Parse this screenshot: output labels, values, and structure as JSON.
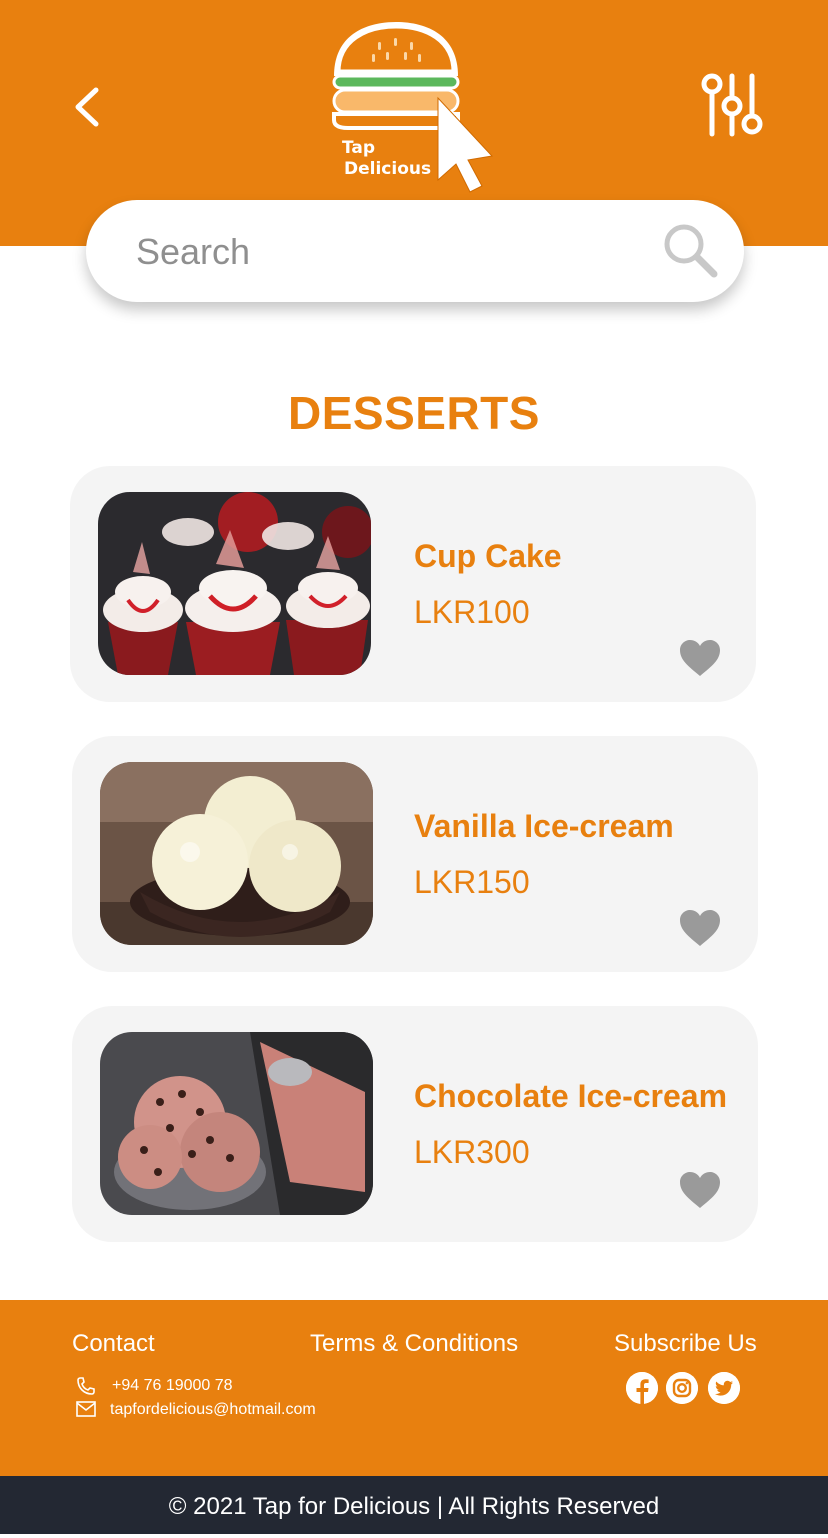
{
  "header": {
    "logo_text_line1": "Tap",
    "logo_text_line2": "Delicious",
    "accent_color": "#E8800F"
  },
  "search": {
    "placeholder": "Search",
    "value": ""
  },
  "section": {
    "title": "DESSERTS"
  },
  "items": [
    {
      "name": "Cup Cake",
      "price": "LKR100",
      "favorite": false
    },
    {
      "name": "Vanilla Ice-cream",
      "price": "LKR150",
      "favorite": false
    },
    {
      "name": "Chocolate Ice-cream",
      "price": "LKR300",
      "favorite": false
    }
  ],
  "footer": {
    "contact_label": "Contact",
    "phone": "+94 76 19000 78",
    "email": "tapfordelicious@hotmail.com",
    "terms_label": "Terms & Conditions",
    "subscribe_label": "Subscribe Us",
    "social": [
      "facebook-icon",
      "instagram-icon",
      "twitter-icon"
    ]
  },
  "copyright": "© 2021 Tap for Delicious | All Rights Reserved"
}
